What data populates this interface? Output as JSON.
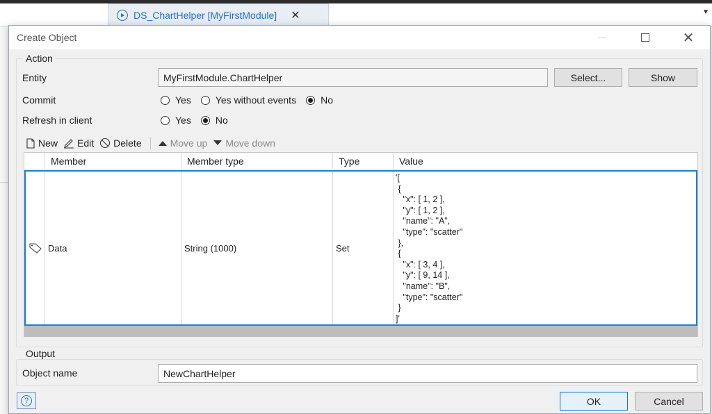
{
  "ide": {
    "doc_tab": "DS_ChartHelper [MyFirstModule]",
    "close_glyph": "✕"
  },
  "dialog": {
    "title": "Create Object",
    "window_buttons": {
      "maximize": "",
      "close": "✕"
    }
  },
  "action": {
    "label": "Action",
    "entity_label": "Entity",
    "entity_value": "MyFirstModule.ChartHelper",
    "select_button": "Select...",
    "show_button": "Show",
    "commit_label": "Commit",
    "commit_options": [
      {
        "label": "Yes",
        "selected": false
      },
      {
        "label": "Yes without events",
        "selected": false
      },
      {
        "label": "No",
        "selected": true
      }
    ],
    "refresh_label": "Refresh in client",
    "refresh_options": [
      {
        "label": "Yes",
        "selected": false
      },
      {
        "label": "No",
        "selected": true
      }
    ]
  },
  "toolbar": {
    "new": "New",
    "edit": "Edit",
    "delete": "Delete",
    "move_up": "Move up",
    "move_down": "Move down"
  },
  "members": {
    "columns": [
      "Member",
      "Member type",
      "Type",
      "Value"
    ],
    "rows": [
      {
        "member": "Data",
        "member_type": "String (1000)",
        "type": "Set",
        "value": "'[\n {\n   \"x\": [ 1, 2 ],\n   \"y\": [ 1, 2 ],\n   \"name\": \"A\",\n   \"type\": \"scatter\"\n },\n {\n   \"x\": [ 3, 4 ],\n   \"y\": [ 9, 14 ],\n   \"name\": \"B\",\n   \"type\": \"scatter\"\n }\n]'"
      }
    ]
  },
  "output": {
    "label": "Output",
    "object_name_label": "Object name",
    "object_name_value": "NewChartHelper"
  },
  "footer": {
    "help": "?",
    "ok": "OK",
    "cancel": "Cancel"
  }
}
